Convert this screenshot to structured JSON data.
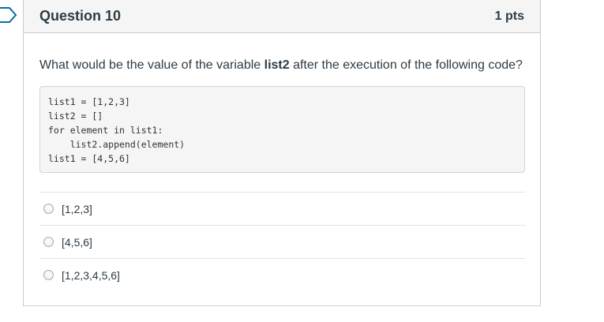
{
  "question": {
    "title": "Question 10",
    "points": "1 pts",
    "text_before": "What would be the value of the variable ",
    "text_bold": "list2",
    "text_after": " after the execution of the following code?",
    "code_lines": [
      "list1 = [1,2,3]",
      "list2 = []",
      "for element in list1:",
      "    list2.append(element)",
      "list1 = [4,5,6]"
    ],
    "answers": [
      {
        "label": "[1,2,3]"
      },
      {
        "label": "[4,5,6]"
      },
      {
        "label": "[1,2,3,4,5,6]"
      }
    ]
  },
  "icons": {
    "flag": "bookmark-flag-icon",
    "flag_color": "#0770a3"
  }
}
